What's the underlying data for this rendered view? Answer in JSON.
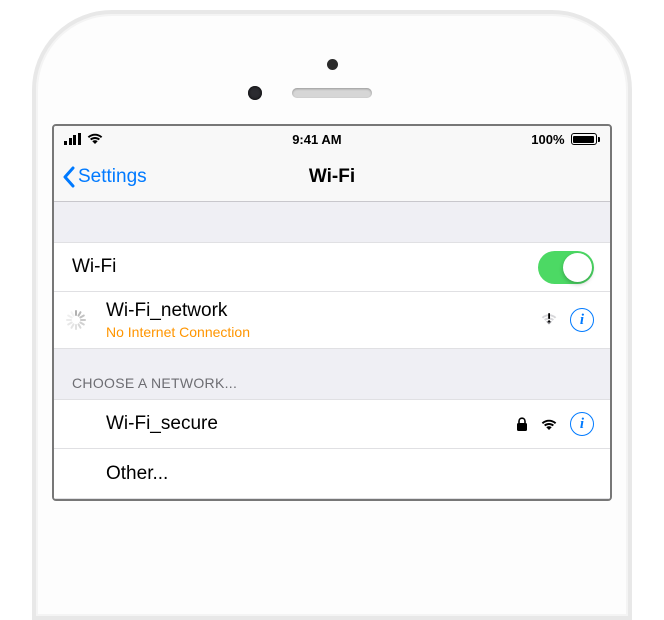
{
  "status": {
    "time": "9:41 AM",
    "battery_pct": "100%"
  },
  "nav": {
    "back_label": "Settings",
    "title": "Wi-Fi"
  },
  "wifi_toggle": {
    "label": "Wi-Fi",
    "enabled": true
  },
  "current_network": {
    "name": "Wi-Fi_network",
    "status": "No Internet Connection"
  },
  "section_header": "CHOOSE A NETWORK...",
  "networks": [
    {
      "name": "Wi-Fi_secure",
      "secured": true
    }
  ],
  "other_label": "Other..."
}
